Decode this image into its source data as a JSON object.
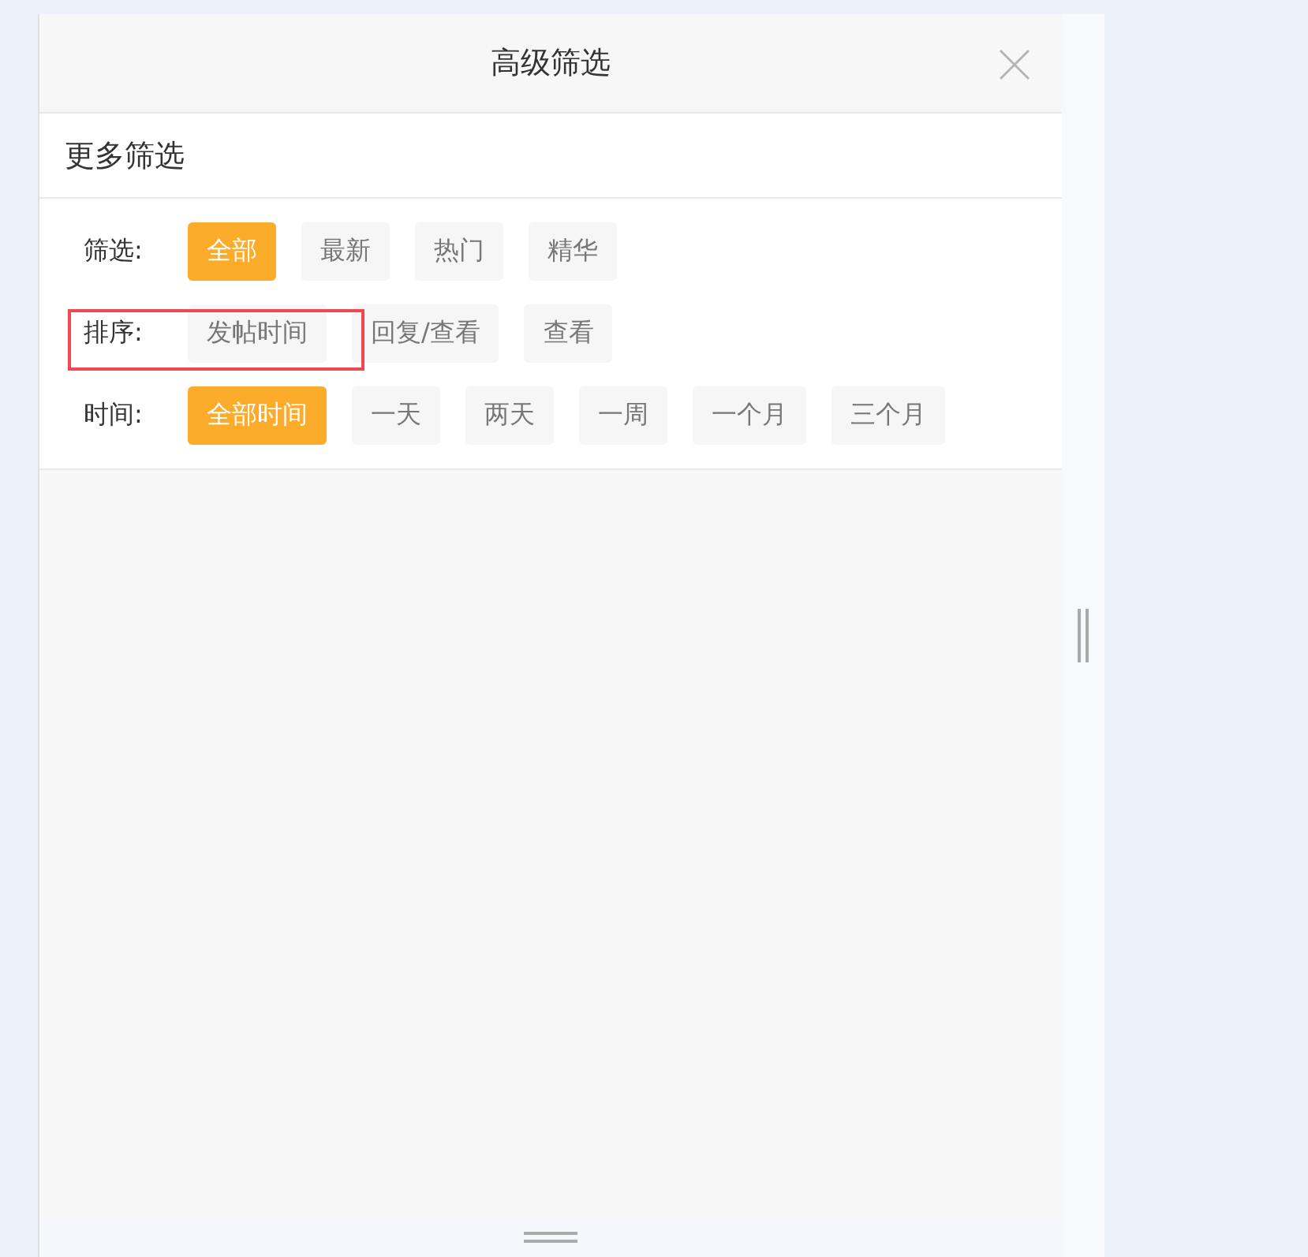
{
  "dialog": {
    "title": "高级筛选",
    "subtitle": "更多筛选"
  },
  "filter_groups": [
    {
      "label": "筛选:",
      "highlighted": false,
      "options": [
        {
          "label": "全部",
          "selected": true
        },
        {
          "label": "最新",
          "selected": false
        },
        {
          "label": "热门",
          "selected": false
        },
        {
          "label": "精华",
          "selected": false
        }
      ]
    },
    {
      "label": "排序:",
      "highlighted": true,
      "options": [
        {
          "label": "发帖时间",
          "selected": false
        },
        {
          "label": "回复/查看",
          "selected": false
        },
        {
          "label": "查看",
          "selected": false
        }
      ]
    },
    {
      "label": "时间:",
      "highlighted": false,
      "options": [
        {
          "label": "全部时间",
          "selected": true
        },
        {
          "label": "一天",
          "selected": false
        },
        {
          "label": "两天",
          "selected": false
        },
        {
          "label": "一周",
          "selected": false
        },
        {
          "label": "一个月",
          "selected": false
        },
        {
          "label": "三个月",
          "selected": false
        }
      ]
    }
  ]
}
